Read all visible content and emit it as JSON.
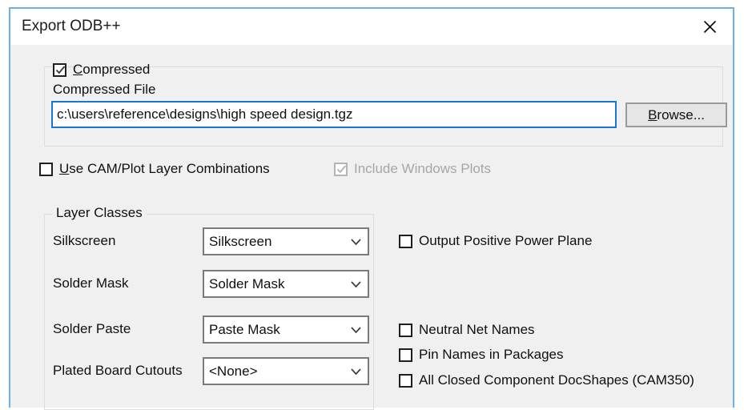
{
  "window": {
    "title": "Export ODB++",
    "close_icon": "close-icon",
    "border_color": "#6cb0e8",
    "titlebar_bg": "#ffffff",
    "dialog_bg": "#f0f0f0"
  },
  "compressed_group": {
    "checkbox": {
      "label_accel": "C",
      "label_rest": "ompressed",
      "checked": true,
      "enabled": true
    },
    "file_label": "Compressed File",
    "file_input": {
      "value": "c:\\users\\reference\\designs\\high speed design.tgz",
      "placeholder": "",
      "focus_border_color": "#1976d2"
    },
    "browse_button": {
      "label_accel": "B",
      "label_rest": "rowse..."
    }
  },
  "options_row": {
    "use_cam_plot": {
      "label_accel": "U",
      "label_rest": "se CAM/Plot Layer Combinations",
      "checked": false,
      "enabled": true
    },
    "include_windows_plots": {
      "label": "Include Windows Plots",
      "checked": true,
      "enabled": false
    }
  },
  "layer_classes": {
    "legend": "Layer Classes",
    "rows": [
      {
        "label": "Silkscreen",
        "value": "Silkscreen",
        "chevron": "chevron-down-icon"
      },
      {
        "label": "Solder Mask",
        "value": "Solder Mask",
        "chevron": "chevron-down-icon"
      },
      {
        "label": "Solder Paste",
        "value": "Paste Mask",
        "chevron": "chevron-down-icon"
      },
      {
        "label": "Plated Board Cutouts",
        "value": "<None>",
        "chevron": "chevron-down-icon"
      }
    ]
  },
  "right_options": [
    {
      "label": "Output Positive Power Plane",
      "checked": false
    },
    {
      "label": "Neutral Net Names",
      "checked": false
    },
    {
      "label": "Pin Names in Packages",
      "checked": false
    },
    {
      "label": "All Closed Component DocShapes (CAM350)",
      "checked": false
    }
  ]
}
